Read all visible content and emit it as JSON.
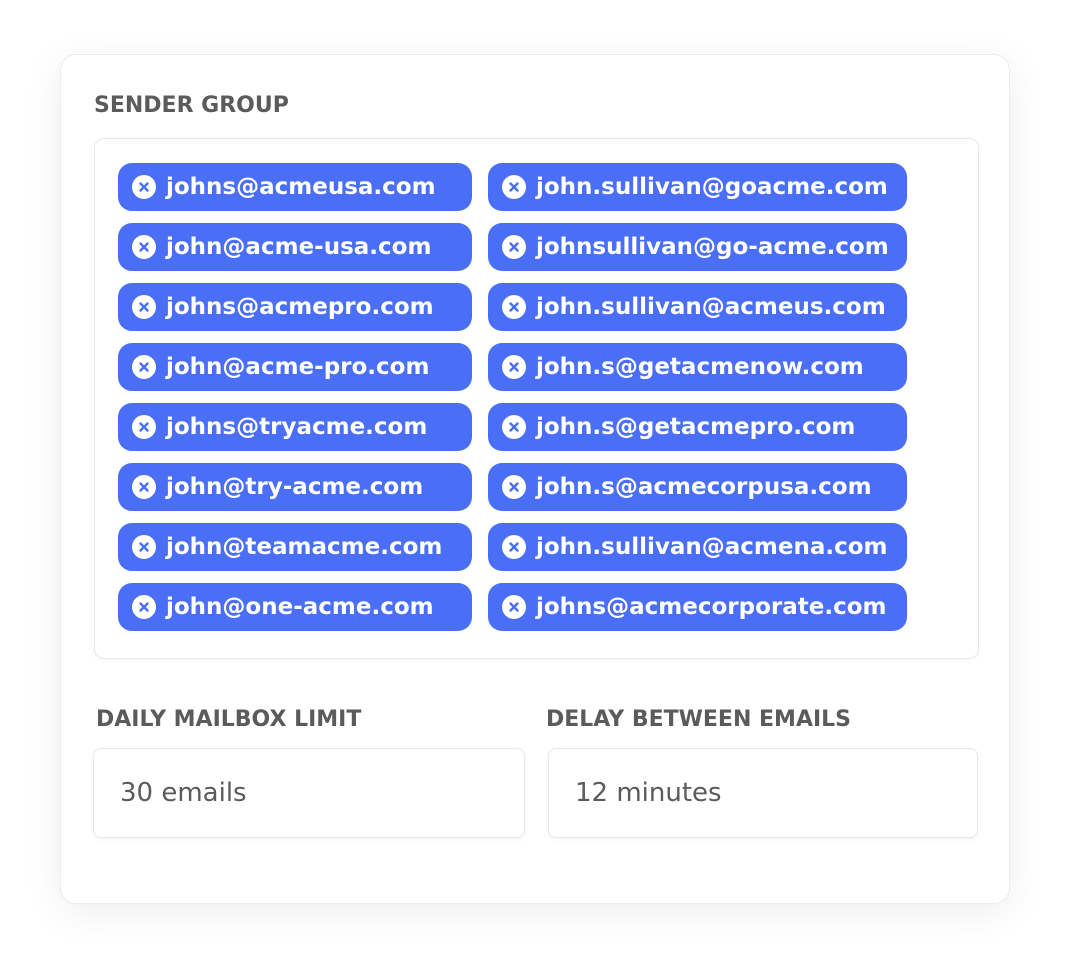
{
  "sender_group": {
    "label": "SENDER GROUP",
    "left_column": [
      "johns@acmeusa.com",
      "john@acme-usa.com",
      "johns@acmepro.com",
      "john@acme-pro.com",
      "johns@tryacme.com",
      "john@try-acme.com",
      "john@teamacme.com",
      "john@one-acme.com"
    ],
    "right_column": [
      "john.sullivan@goacme.com",
      "johnsullivan@go-acme.com",
      "john.sullivan@acmeus.com",
      "john.s@getacmenow.com",
      "john.s@getacmepro.com",
      "john.s@acmecorpusa.com",
      "john.sullivan@acmena.com",
      "johns@acmecorporate.com"
    ],
    "remove_icon": "close-circle-icon"
  },
  "daily_limit": {
    "label": "DAILY MAILBOX LIMIT",
    "value": "30 emails"
  },
  "delay": {
    "label": "DELAY BETWEEN EMAILS",
    "value": "12 minutes"
  },
  "colors": {
    "chip": "#4a6ef5",
    "label": "#5b5b5b",
    "border": "#e8e8e8"
  }
}
